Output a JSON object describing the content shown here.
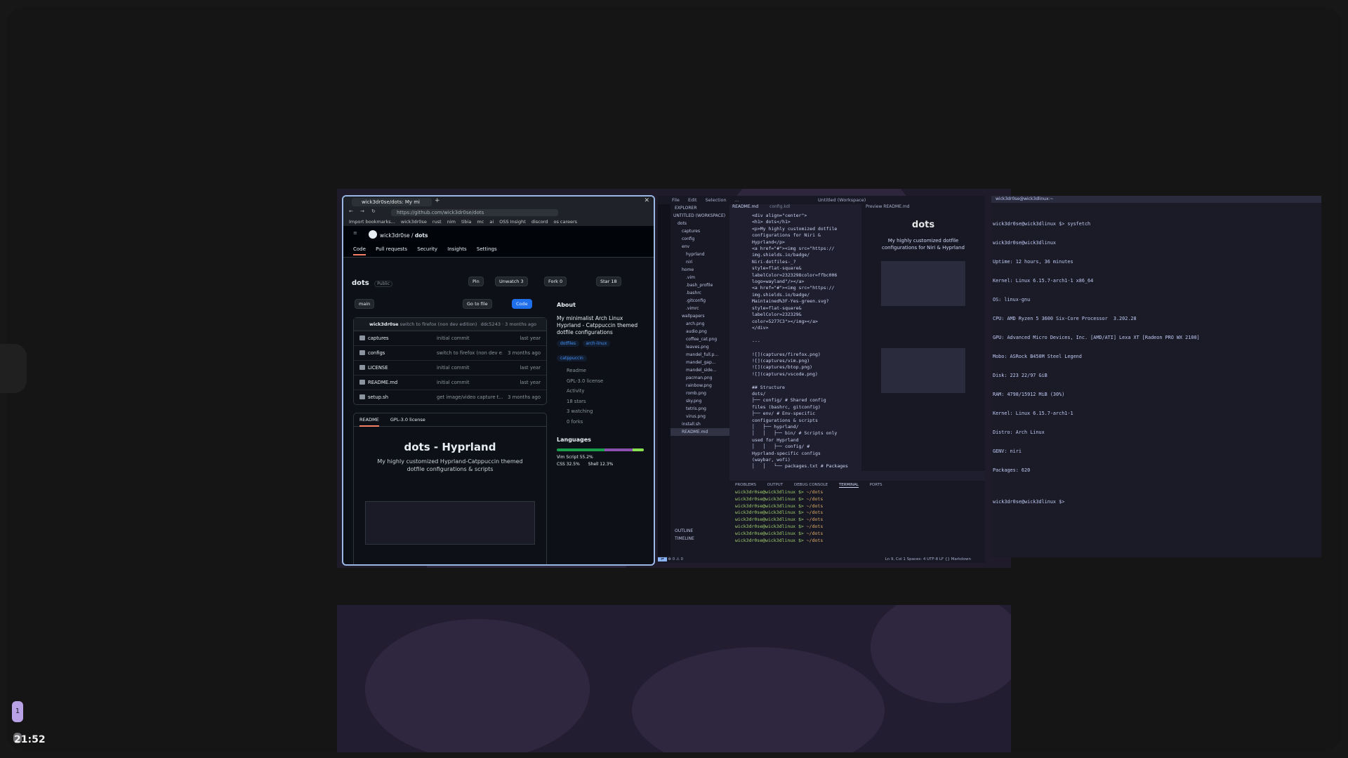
{
  "clock": "21:52",
  "workspaces": [
    "1"
  ],
  "firefox": {
    "tab_title": "wick3dr0se/dots: My mi",
    "url": "https://github.com/wick3dr0se/dots",
    "bookmarks": [
      "Import bookmarks...",
      "wick3dr0se",
      "rust",
      "nim",
      "tibia",
      "mc",
      "ai",
      "OSS Insight",
      "discord",
      "os careers"
    ],
    "crumb_owner": "wick3dr0se",
    "crumb_repo": "dots",
    "nav": [
      "Code",
      "Pull requests",
      "Security",
      "Insights",
      "Settings"
    ],
    "repo_name": "dots",
    "visibility": "Public",
    "buttons": {
      "pin": "Pin",
      "unwatch": "Unwatch",
      "unwatch_count": "3",
      "fork": "Fork",
      "fork_count": "0",
      "star": "Star",
      "star_count": "18",
      "branch": "main",
      "go_to_file": "Go to file",
      "code": "Code"
    },
    "last_commit": {
      "author": "wick3dr0se",
      "message": "switch to firefox (non dev edition)",
      "meta": "ddc5243 · 3 months ago"
    },
    "files": [
      {
        "name": "captures",
        "commit": "initial commit",
        "time": "last year"
      },
      {
        "name": "configs",
        "commit": "switch to firefox (non dev e...",
        "time": "3 months ago"
      },
      {
        "name": "LICENSE",
        "commit": "initial commit",
        "time": "last year"
      },
      {
        "name": "README.md",
        "commit": "initial commit",
        "time": "last year"
      },
      {
        "name": "setup.sh",
        "commit": "get image/video capture t...",
        "time": "3 months ago"
      }
    ],
    "readme_tabs": [
      "README",
      "GPL-3.0 license"
    ],
    "readme_title": "dots - Hyprland",
    "readme_desc": "My highly customized Hyprland-Catppuccin themed dotfile configurations & scripts",
    "about": {
      "title": "About",
      "desc": "My minimalist Arch Linux Hyprland - Catppuccin themed dotfile configurations",
      "topics": [
        "dotfiles",
        "arch-linux",
        "catppuccin"
      ],
      "links": [
        "Readme",
        "GPL-3.0 license",
        "Activity",
        "18 stars",
        "3 watching",
        "0 forks"
      ]
    },
    "languages": {
      "title": "Languages",
      "items": [
        "Vim Script 55.2%",
        "CSS 32.5%",
        "Shell 12.3%"
      ]
    }
  },
  "vscode": {
    "menu": [
      "File",
      "Edit",
      "Selection",
      "..."
    ],
    "title": "Untitled (Workspace)",
    "explorer_header": "EXPLORER",
    "workspace": "UNTITLED (WORKSPACE)",
    "tree": [
      "dots",
      "captures",
      "config",
      "env",
      "hyprland",
      "niri",
      "home",
      ".vim",
      ".bash_profile",
      ".bashrc",
      ".gitconfig",
      ".vimrc",
      "wallpapers",
      "arch.png",
      "audio.png",
      "coffee_cat.png",
      "leaves.png",
      "mandel_full.p...",
      "mandel_gap...",
      "mandel_side...",
      "pacman.png",
      "rainbow.png",
      "romb.png",
      "sky.png",
      "tetris.png",
      "virus.png",
      "install.sh",
      "README.md"
    ],
    "editor_tabs": [
      "README.md",
      "config.kdl",
      "Preview README.md"
    ],
    "code": "<div align=\"center\">\n<h1> dots</h1>\n<p>My highly customized dotfile\nconfigurations for Niri &\nHyprland</p>\n<a href=\"#\"><img src=\"https://\nimg.shields.io/badge/\nNiri-dotfiles-_?\nstyle=flat-square&\nlabelColor=2323298color=ffbc006\nlogo=wayland\"/></a>\n<a href=\"#\"><img src=\"https://\nimg.shields.io/badge/\nMaintained%3F-Yes-green.svg?\nstyle=flat-square&\nlabelColor=232329&\ncolor=5277C3\"></img></a>\n</div>\n\n---\n\n![](captures/firefox.png)\n![](captures/vim.png)\n![](captures/btop.png)\n![](captures/vscode.png)\n\n## Structure\ndots/\n├── config/ # Shared config\nfiles (bashrc, gitconfig)\n├── env/ # Env-specific\nconfigurations & scripts\n│   ├── hyprland/\n│   │   ├── bin/ # Scripts only\nused for Hyprland\n│   │   ├── config/ #\nHyprland-specific configs\n(waybar, wofi)\n│   │   └── packages.txt # Packages",
    "preview_title": "dots",
    "preview_desc": "My highly customized dotfile configurations for Niri & Hyprland",
    "panel_tabs": [
      "PROBLEMS",
      "OUTPUT",
      "DEBUG CONSOLE",
      "TERMINAL",
      "PORTS"
    ],
    "terminal_prompt": "wick3dr0se@wick3dlinux $>",
    "terminal_path": "~/dots",
    "sidebar_bottom": [
      "OUTLINE",
      "TIMELINE"
    ],
    "status": {
      "left": "⊗ 0 ⚠ 0",
      "right": "Ln 9, Col 1   Spaces: 4   UTF-8   LF   {} Markdown"
    }
  },
  "terminal": {
    "title": "wick3dr0se@wick3dlinux:~",
    "lines": [
      "wick3dr0se@wick3dlinux $> sysfetch",
      "wick3dr0se@wick3dlinux",
      "Uptime: 12 hours, 36 minutes",
      "Kernel: Linux 6.15.7-arch1-1 x86_64",
      "OS: linux-gnu",
      "CPU: AMD Ryzen 5 3600 Six-Core Processor  3.202.28",
      "GPU: Advanced Micro Devices, Inc. [AMD/ATI] Lexa XT [Radeon PRO WX 2100]",
      "Mobo: ASRock B450M Steel Legend",
      "Disk: 223 22/97 GiB",
      "RAM: 4798/15912 MiB (30%)",
      "Kernel: Linux 6.15.7-arch1-1",
      "Distro: Arch Linux",
      "GENV: niri",
      "Packages: 620",
      "",
      "wick3dr0se@wick3dlinux $> "
    ]
  }
}
